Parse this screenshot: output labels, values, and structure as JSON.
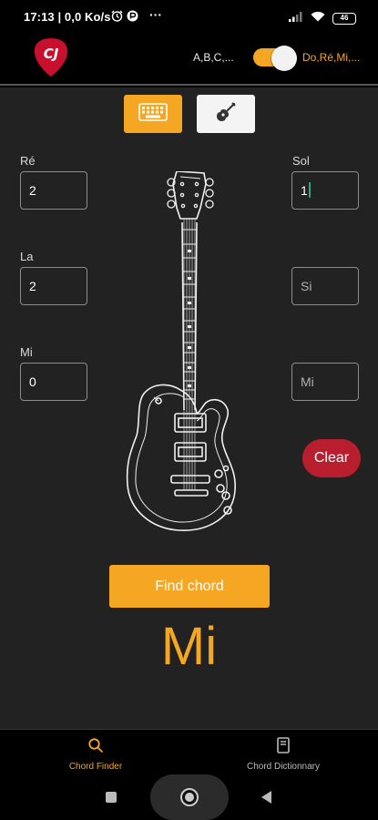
{
  "status_bar": {
    "left_text": "17:13 | 0,0 Ko/s",
    "battery": "46"
  },
  "header": {
    "logo_text": "CJ",
    "notation_left": "A,B,C,...",
    "notation_right": "Do,Ré,Mi,...",
    "toggle_on": true
  },
  "mode_buttons": {
    "keyboard_icon": "keyboard-icon",
    "guitar_icon": "guitar-icon"
  },
  "strings": {
    "re": {
      "label": "Ré",
      "value": "2",
      "placeholder": "Ré"
    },
    "la": {
      "label": "La",
      "value": "2",
      "placeholder": "La"
    },
    "mi_low": {
      "label": "Mi",
      "value": "0",
      "placeholder": "Mi"
    },
    "sol": {
      "label": "Sol",
      "value": "1",
      "placeholder": "Sol"
    },
    "si": {
      "label": "",
      "value": "",
      "placeholder": "Si"
    },
    "mi_high": {
      "label": "",
      "value": "",
      "placeholder": "Mi"
    }
  },
  "buttons": {
    "clear": "Clear",
    "find_chord": "Find chord"
  },
  "result": {
    "chord": "Mi"
  },
  "bottom_nav": {
    "items": [
      {
        "label": "Chord Finder",
        "icon": "search-icon",
        "active": true
      },
      {
        "label": "Chord Dictionnary",
        "icon": "book-icon",
        "active": false
      }
    ]
  },
  "colors": {
    "accent": "#f5a623",
    "clear": "#b81e2e",
    "panel": "#222222"
  }
}
